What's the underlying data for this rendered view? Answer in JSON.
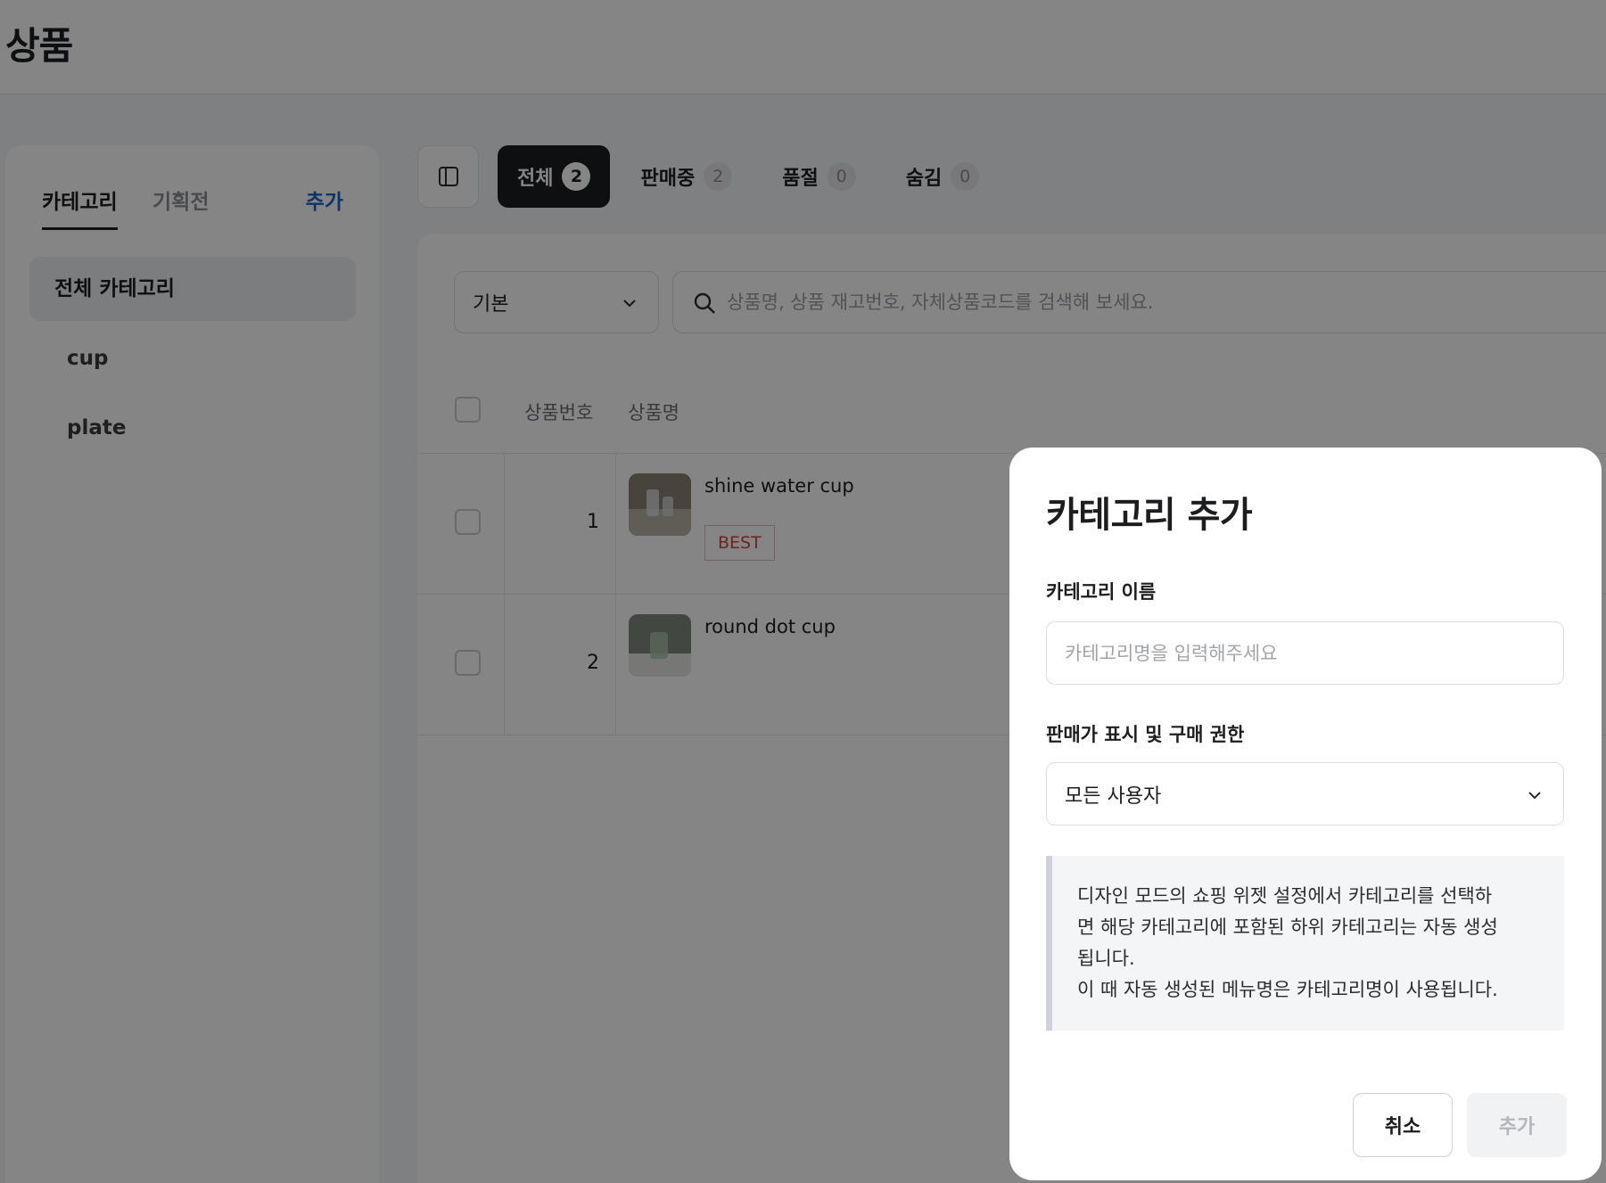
{
  "header": {
    "title": "상품"
  },
  "sidebar": {
    "tabs": [
      {
        "label": "카테고리",
        "active": true
      },
      {
        "label": "기획전",
        "active": false
      }
    ],
    "add_label": "추가",
    "items": [
      {
        "label": "전체 카테고리",
        "selected": true
      },
      {
        "label": "cup",
        "selected": false
      },
      {
        "label": "plate",
        "selected": false
      }
    ]
  },
  "status_tabs": [
    {
      "label": "전체",
      "count": "2",
      "active": true
    },
    {
      "label": "판매중",
      "count": "2",
      "active": false
    },
    {
      "label": "품절",
      "count": "0",
      "active": false
    },
    {
      "label": "숨김",
      "count": "0",
      "active": false
    }
  ],
  "toolbar": {
    "sort_value": "기본",
    "search_placeholder": "상품명, 상품 재고번호, 자체상품코드를 검색해 보세요."
  },
  "table": {
    "columns": [
      "상품번호",
      "상품명"
    ],
    "rows": [
      {
        "number": "1",
        "name": "shine water cup",
        "badge": "BEST"
      },
      {
        "number": "2",
        "name": "round dot cup",
        "badge": ""
      }
    ]
  },
  "modal": {
    "title": "카테고리 추가",
    "name_label": "카테고리 이름",
    "name_placeholder": "카테고리명을 입력해주세요",
    "permission_label": "판매가 표시 및 구매 권한",
    "permission_value": "모든 사용자",
    "info_line1": "디자인 모드의 쇼핑 위젯 설정에서 카테고리를 선택하",
    "info_line2": "면 해당 카테고리에 포함된 하위 카테고리는 자동 생성",
    "info_line3": "됩니다.",
    "info_line4": "이 때 자동 생성된 메뉴명은 카테고리명이 사용됩니다.",
    "cancel_label": "취소",
    "confirm_label": "추가"
  },
  "colors": {
    "accent_link": "#1a64c8",
    "badge_red": "#d8443c",
    "active_tab_bg": "#1c1d1f"
  }
}
